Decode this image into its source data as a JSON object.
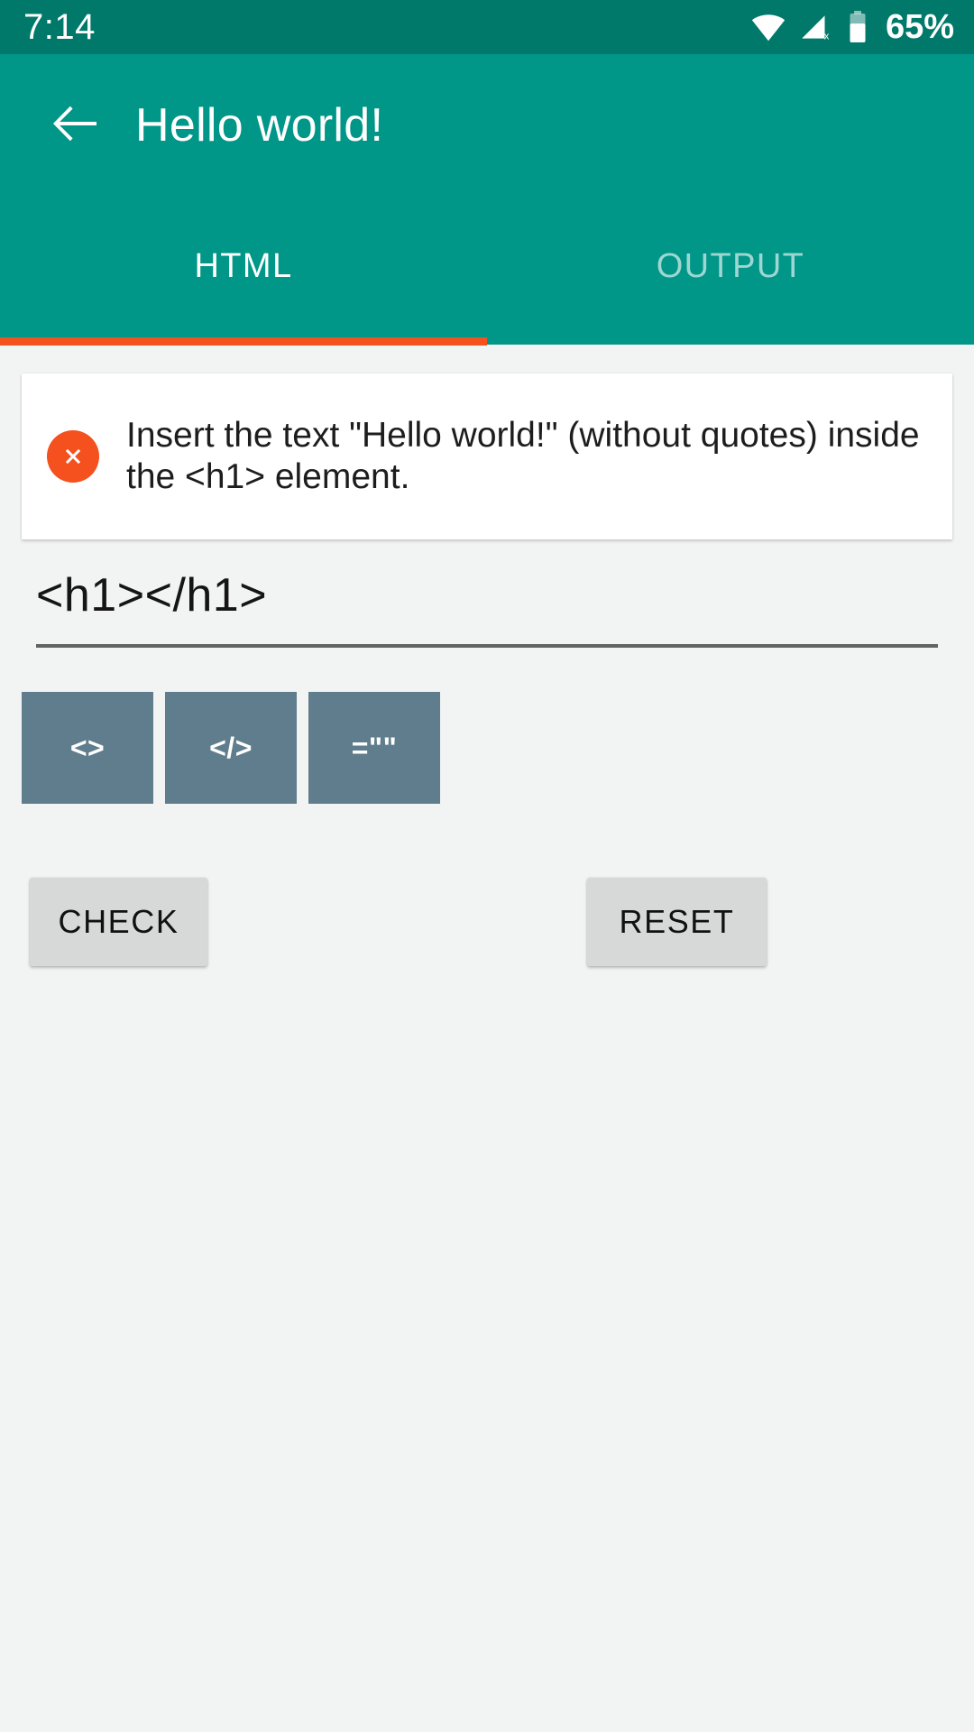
{
  "status_bar": {
    "time": "7:14",
    "battery_percent": "65%",
    "icons": [
      "wifi-icon",
      "cellular-signal-off-icon",
      "battery-icon"
    ],
    "background_color": "#00796B"
  },
  "app_bar": {
    "back_icon": "back-arrow-icon",
    "title": "Hello world!",
    "background_color": "#009688",
    "indicator_color": "#F4511E",
    "tabs": [
      {
        "label": "HTML",
        "active": true
      },
      {
        "label": "OUTPUT",
        "active": false
      }
    ]
  },
  "instruction_card": {
    "status_icon": "error-circle-x-icon",
    "status_icon_color": "#F4511E",
    "text": "Insert the text \"Hello world!\" (without quotes) inside the <h1> element."
  },
  "code_editor": {
    "value": "<h1></h1>",
    "placeholder": "",
    "tag_buttons": [
      {
        "label": "<>",
        "name": "insert-open-tag-button"
      },
      {
        "label": "</>",
        "name": "insert-close-tag-button"
      },
      {
        "label": "=\"\"",
        "name": "insert-attribute-button"
      }
    ],
    "tag_button_color": "#5F7D8C"
  },
  "actions": {
    "check_label": "CHECK",
    "reset_label": "RESET",
    "button_color": "#D7D8D8"
  }
}
